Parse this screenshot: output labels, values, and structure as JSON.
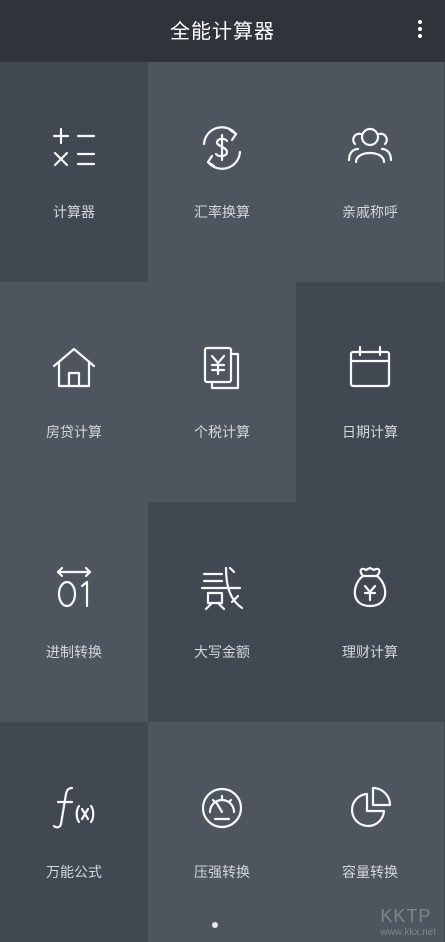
{
  "app": {
    "title": "全能计算器"
  },
  "tiles": [
    {
      "label": "计算器",
      "icon": "calculator-icon"
    },
    {
      "label": "汇率换算",
      "icon": "currency-exchange-icon"
    },
    {
      "label": "亲戚称呼",
      "icon": "people-icon"
    },
    {
      "label": "房贷计算",
      "icon": "house-icon"
    },
    {
      "label": "个税计算",
      "icon": "tax-document-icon"
    },
    {
      "label": "日期计算",
      "icon": "calendar-icon"
    },
    {
      "label": "进制转换",
      "icon": "binary-icon"
    },
    {
      "label": "大写金额",
      "icon": "chinese-numeral-icon"
    },
    {
      "label": "理财计算",
      "icon": "money-bag-icon"
    },
    {
      "label": "万能公式",
      "icon": "function-icon"
    },
    {
      "label": "压强转换",
      "icon": "gauge-icon"
    },
    {
      "label": "容量转换",
      "icon": "pie-chart-icon"
    }
  ],
  "watermark": {
    "text": "KKTP",
    "sub": "www.kkx.net"
  }
}
